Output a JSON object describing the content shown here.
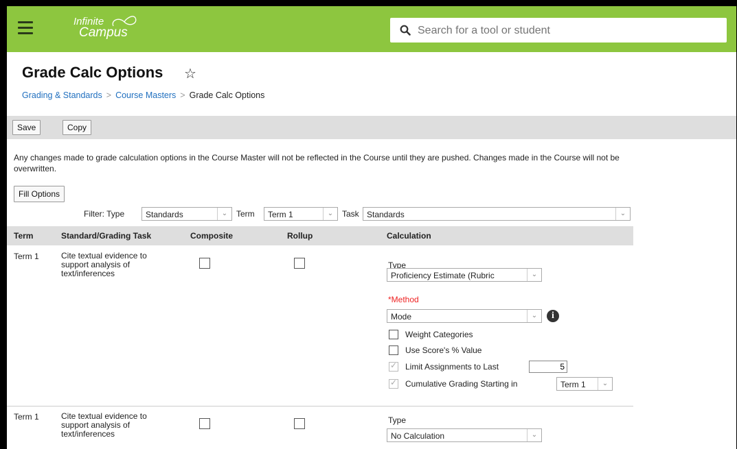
{
  "header": {
    "logo_line1": "Infinite",
    "logo_line2": "Campus",
    "search_placeholder": "Search for a tool or student",
    "bar_color": "#8dc63f"
  },
  "page": {
    "title": "Grade Calc Options",
    "breadcrumb": [
      "Grading & Standards",
      "Course Masters",
      "Grade Calc Options"
    ]
  },
  "toolbar": {
    "save_label": "Save",
    "copy_label": "Copy"
  },
  "notice": "Any changes made to grade calculation options in the Course Master will not be reflected in the Course until they are pushed. Changes made in the Course will not be overwritten.",
  "fill_options_label": "Fill Options",
  "filter": {
    "label": "Filter: Type",
    "type_value": "Standards",
    "term_label": "Term",
    "term_value": "Term 1",
    "task_label": "Task",
    "task_value": "Standards"
  },
  "table": {
    "headers": [
      "Term",
      "Standard/Grading Task",
      "Composite",
      "Rollup",
      "Calculation"
    ],
    "rows": [
      {
        "term": "Term 1",
        "task": [
          "Cite textual evidence to",
          "support analysis of",
          "text/inferences"
        ],
        "type_label": "Type",
        "type_value": "Proficiency Estimate (Rubric",
        "method_label": "*Method",
        "method_value": "Mode",
        "options": {
          "weight_categories": "Weight Categories",
          "use_score": "Use Score's % Value",
          "limit_assignments": "Limit Assignments to Last",
          "limit_value": "5",
          "cumulative": "Cumulative Grading Starting in",
          "cumulative_value": "Term 1"
        }
      },
      {
        "term": "Term 1",
        "task": [
          "Cite textual evidence to",
          "support analysis of",
          "text/inferences"
        ],
        "type_label": "Type",
        "type_value": "No Calculation"
      }
    ]
  }
}
